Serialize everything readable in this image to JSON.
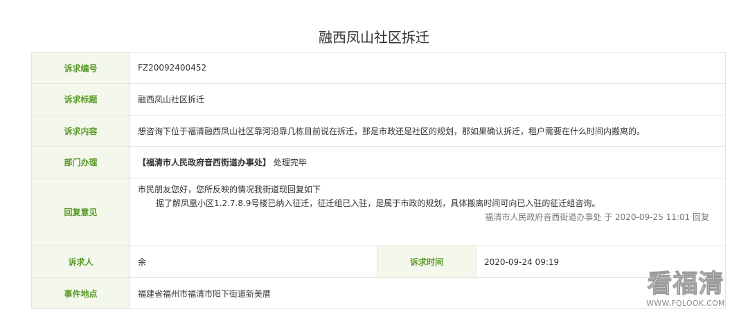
{
  "page": {
    "title": "融西凤山社区拆迁"
  },
  "rows": {
    "case_no": {
      "label": "诉求编号",
      "value": "FZ20092400452"
    },
    "case_title": {
      "label": "诉求标题",
      "value": "融西凤山社区拆迁"
    },
    "case_content": {
      "label": "诉求内容",
      "value": "想咨询下位于福清融西凤山社区靠河沿靠几栋目前说在拆迁，那是市政还是社区的规划，那如果确认拆迁，租户需要在什么时间内搬离的。"
    },
    "department": {
      "label": "部门办理",
      "name": "【福清市人民政府音西街道办事处】",
      "status": "处理完毕"
    },
    "reply": {
      "label": "回复意见",
      "line1": "市民朋友您好，您所反映的情况我街道现回复如下",
      "line2": "据了解凤凰小区1.2.7.8.9号楼已纳入征迁，征迁组已入驻，是属于市政的规划，具体搬离时间可向已入驻的征迁组咨询。",
      "signature": "福清市人民政府音西街道办事处 于 2020-09-25 11:01 回复"
    },
    "petitioner": {
      "label": "诉求人",
      "value": "余"
    },
    "petition_time": {
      "label": "诉求时间",
      "value": "2020-09-24 09:19"
    },
    "location": {
      "label": "事件地点",
      "value": "福建省福州市福清市阳下街道新美厝"
    }
  },
  "watermark": {
    "logo_text": "看福清",
    "url": "WWW.FQLOOK.COM"
  }
}
